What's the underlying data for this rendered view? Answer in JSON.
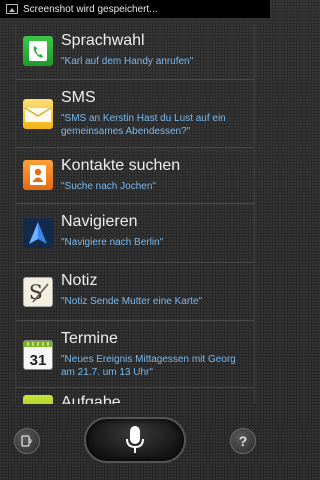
{
  "statusbar": {
    "text": "Screenshot wird gespeichert..."
  },
  "items": [
    {
      "title": "Sprachwahl",
      "sub": "\"Karl auf dem Handy anrufen\"",
      "icon": "phone-icon"
    },
    {
      "title": "SMS",
      "sub": "\"SMS an Kerstin Hast du Lust auf ein gemeinsames Abendessen?\"",
      "icon": "envelope-icon"
    },
    {
      "title": "Kontakte suchen",
      "sub": "\"Suche nach Jochen\"",
      "icon": "contact-icon"
    },
    {
      "title": "Navigieren",
      "sub": "\"Navigiere nach Berlin\"",
      "icon": "navigation-arrow-icon"
    },
    {
      "title": "Notiz",
      "sub": "\"Notiz Sende Mutter eine Karte\"",
      "icon": "note-icon"
    },
    {
      "title": "Termine",
      "sub": "\"Neues Ereignis Mittagessen mit Georg am 21.7. um 13 Uhr\"",
      "icon": "calendar-icon",
      "cal_day": "31"
    },
    {
      "title": "Aufgabe",
      "sub": "",
      "icon": "task-icon"
    }
  ],
  "bottom": {
    "help_label": "?"
  }
}
